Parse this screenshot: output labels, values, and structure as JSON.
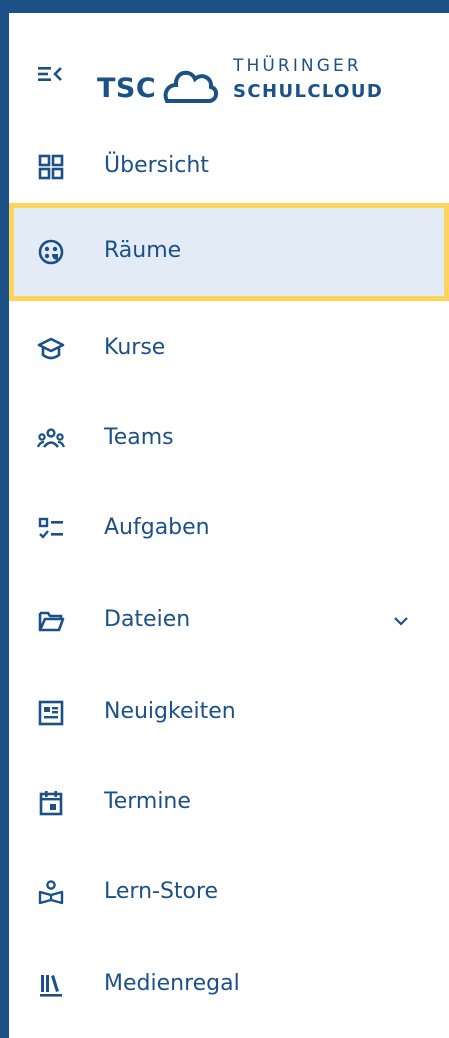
{
  "colors": {
    "frame": "#1b5187",
    "primary": "#1b5187",
    "active_background": "#e3ebf6",
    "focus_ring": "#ffd45c",
    "panel": "#ffffff"
  },
  "header": {
    "collapse_icon": "menu-collapse-icon",
    "logo": {
      "abbrev": "TSC",
      "line1": "THÜRINGER",
      "line2": "SCHULCLOUD"
    }
  },
  "nav": {
    "items": [
      {
        "label": "Übersicht",
        "icon": "dashboard-grid-icon",
        "active": false
      },
      {
        "label": "Räume",
        "icon": "rooms-icon",
        "active": true
      },
      {
        "label": "Kurse",
        "icon": "graduation-cap-icon",
        "active": false
      },
      {
        "label": "Teams",
        "icon": "account-group-icon",
        "active": false
      },
      {
        "label": "Aufgaben",
        "icon": "task-list-icon",
        "active": false
      },
      {
        "label": "Dateien",
        "icon": "folder-open-icon",
        "active": false,
        "expandable": true,
        "chevron": "chevron-down-icon"
      },
      {
        "label": "Neuigkeiten",
        "icon": "newspaper-icon",
        "active": false
      },
      {
        "label": "Termine",
        "icon": "calendar-icon",
        "active": false
      },
      {
        "label": "Lern-Store",
        "icon": "learning-store-icon",
        "active": false
      },
      {
        "label": "Medienregal",
        "icon": "bookshelf-icon",
        "active": false
      }
    ]
  }
}
